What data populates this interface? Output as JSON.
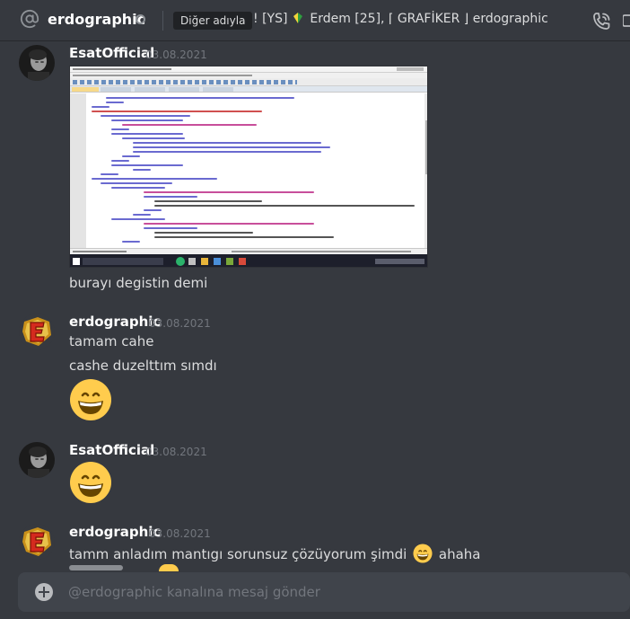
{
  "header": {
    "channel_name": "erdographic",
    "nickname_badge": "Diğer adıyla",
    "nickname_prefix": "! [YS]",
    "nickname_suffix": "Erdem [25], ⌈ GRAFİKER ⌋ erdographic"
  },
  "messages": [
    {
      "author": "EsatOfficial",
      "timestamp": "03.08.2021",
      "avatar": "dark-portrait-avatar",
      "attachment": "notepad-plus-plus-html-screenshot",
      "text": "burayı degistin demi"
    },
    {
      "author": "erdographic",
      "timestamp": "03.08.2021",
      "avatar": "red-e-logo-avatar",
      "lines": [
        "tamam cahe",
        "cashe duzelttım sımdı"
      ],
      "emoji": "grinning-face-emoji"
    },
    {
      "author": "EsatOfficial",
      "timestamp": "03.08.2021",
      "avatar": "dark-portrait-avatar",
      "emoji": "grinning-face-emoji"
    },
    {
      "author": "erdographic",
      "timestamp": "03.08.2021",
      "avatar": "red-e-logo-avatar",
      "text_before": "tamm anladım mantıgı sorunsuz çözüyorum şimdi",
      "text_after": "ahaha"
    }
  ],
  "composer": {
    "placeholder": "@erdographic kanalına mesaj gönder"
  },
  "colors": {
    "background": "#36393f",
    "input_background": "#40444b",
    "text": "#dcddde",
    "timestamp": "#72767d",
    "username": "#ffffff"
  }
}
